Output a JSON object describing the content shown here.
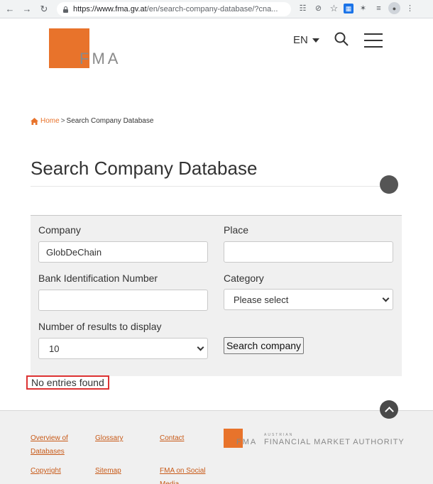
{
  "browser": {
    "url_host": "https://www.fma.gv.at",
    "url_path": "/en/search-company-database/?cna..."
  },
  "header": {
    "logo_text": "FMA",
    "language": "EN"
  },
  "breadcrumb": {
    "home": "Home",
    "separator": ">",
    "current": "Search Company Database"
  },
  "page": {
    "title": "Search Company Database"
  },
  "form": {
    "company_label": "Company",
    "company_value": "GlobDeChain",
    "place_label": "Place",
    "place_value": "",
    "bin_label": "Bank Identification Number",
    "bin_value": "",
    "category_label": "Category",
    "category_selected": "Please select",
    "results_label": "Number of results to display",
    "results_selected": "10",
    "search_button": "Search company"
  },
  "results": {
    "message": "No entries found"
  },
  "footer": {
    "links": [
      "Overview of Databases",
      "Glossary",
      "Contact",
      "Copyright",
      "Sitemap",
      "FMA on Social Media"
    ],
    "logo_austrian": "AUSTRIAN",
    "logo_fma": "FMA",
    "logo_name": "FINANCIAL MARKET AUTHORITY"
  },
  "colors": {
    "brand": "#e8732b",
    "highlight_border": "#dd3333"
  }
}
